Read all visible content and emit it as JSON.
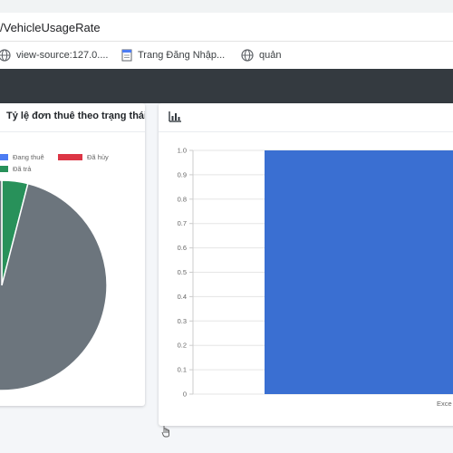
{
  "browser": {
    "url": "/VehicleUsageRate",
    "bookmarks": [
      {
        "label": "view-source:127.0....",
        "icon": "globe-icon"
      },
      {
        "label": "Trang Đăng Nhập...",
        "icon": "page-icon"
      },
      {
        "label": "quản",
        "icon": "globe-icon"
      }
    ]
  },
  "pie_card": {
    "title": "Tỷ lệ đơn thuê theo trạng thái",
    "legend": [
      {
        "label": "Đang thuê",
        "color": "#4c7cf3"
      },
      {
        "label": "Đã hủy",
        "color": "#dc3545"
      },
      {
        "label": "Đã trả",
        "color": "#28915a"
      }
    ]
  },
  "bar_card": {
    "header_icon": "bar-chart-icon",
    "x_tick_visible": "Exce"
  },
  "chart_data": [
    {
      "type": "pie",
      "title": "Tỷ lệ đơn thuê theo trạng thái",
      "legend_position": "top",
      "slices": [
        {
          "label": "Đã trả",
          "value": 0.04,
          "color": "#28915a"
        },
        {
          "label": "(unlabeled grey)",
          "value": 0.96,
          "color": "#6c757d"
        }
      ]
    },
    {
      "type": "bar",
      "categories": [
        "Exce"
      ],
      "values": [
        1.0
      ],
      "color": "#3a6fd2",
      "ylim": [
        0,
        1.0
      ],
      "yticks": [
        "0",
        "0.1",
        "0.2",
        "0.3",
        "0.4",
        "0.5",
        "0.6",
        "0.7",
        "0.8",
        "0.9",
        "1.0"
      ],
      "grid": true
    }
  ]
}
